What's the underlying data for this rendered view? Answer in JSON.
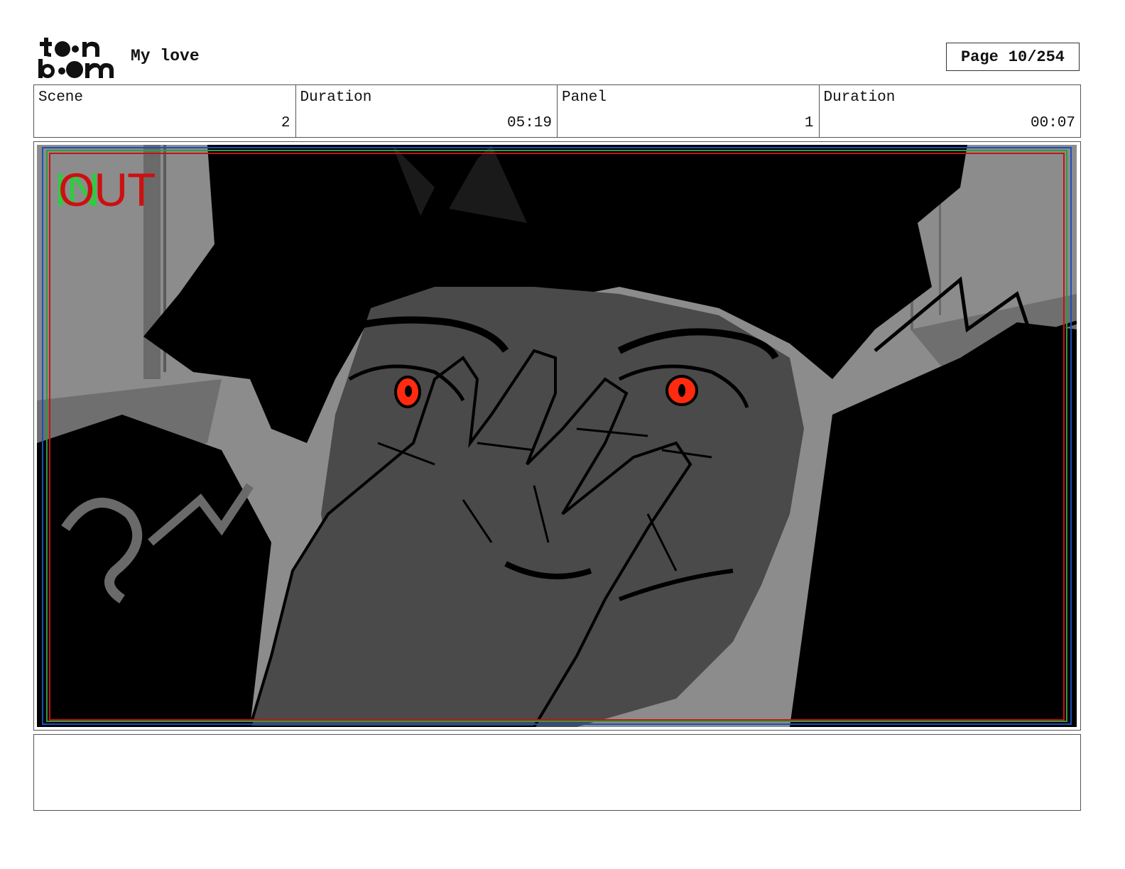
{
  "header": {
    "logo_alt": "toon boom",
    "project_title": "My love",
    "page_label": "Page",
    "page_value": "10/254"
  },
  "info": {
    "scene_label": "Scene",
    "scene_value": "2",
    "scene_duration_label": "Duration",
    "scene_duration_value": "05:19",
    "panel_label": "Panel",
    "panel_value": "1",
    "panel_duration_label": "Duration",
    "panel_duration_value": "00:07"
  },
  "panel": {
    "in_marker": "IN",
    "out_marker": "OUT",
    "colors": {
      "background": "#8c8c8c",
      "shadow": "#000000",
      "skin": "#4a4a4a",
      "eyes": "#ff2a10",
      "in_marker": "#2ecc40",
      "out_marker": "#cc1010"
    }
  },
  "caption": {
    "text": ""
  }
}
